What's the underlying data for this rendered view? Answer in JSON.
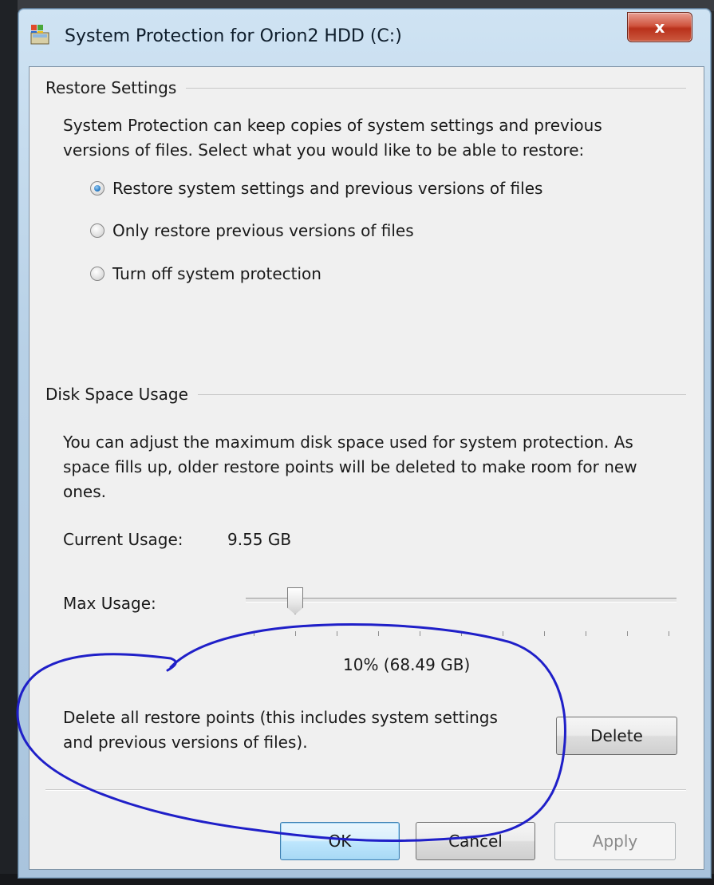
{
  "window": {
    "title": "System Protection for Orion2 HDD (C:)",
    "close_label": "x"
  },
  "restore_settings": {
    "group_title": "Restore Settings",
    "description_line1": "System Protection can keep copies of system settings and previous",
    "description_line2": "versions of files. Select what you would like to be able to restore:",
    "options": [
      {
        "label": "Restore system settings and previous versions of files",
        "selected": true
      },
      {
        "label": "Only restore previous versions of files",
        "selected": false
      },
      {
        "label": "Turn off system protection",
        "selected": false
      }
    ]
  },
  "disk_space": {
    "group_title": "Disk Space Usage",
    "description_line1": "You can adjust the maximum disk space used for system protection. As",
    "description_line2": "space fills up, older restore points will be deleted to make room for new",
    "description_line3": "ones.",
    "current_usage_label": "Current Usage:",
    "current_usage_value": "9.55 GB",
    "max_usage_label": "Max Usage:",
    "max_usage_percent": 10,
    "max_usage_value": "10% (68.49 GB)",
    "delete_text_line1": "Delete all restore points (this includes system settings",
    "delete_text_line2": "and previous versions of files).",
    "delete_button": "Delete"
  },
  "footer": {
    "ok": "OK",
    "cancel": "Cancel",
    "apply": "Apply"
  },
  "colors": {
    "annotation_ink": "#1f1fc8",
    "close_red": "#c8412a",
    "title_blue": "#b7d0e6"
  }
}
